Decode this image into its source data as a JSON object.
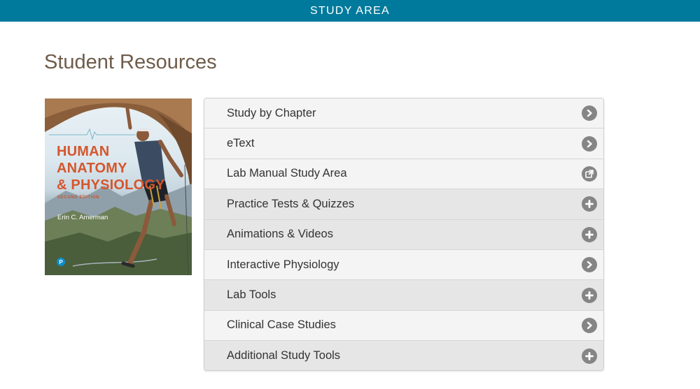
{
  "header": {
    "title": "STUDY AREA"
  },
  "page": {
    "title": "Student Resources"
  },
  "book": {
    "title_lines": [
      "HUMAN",
      "ANATOMY",
      "& PHYSIOLOGY"
    ],
    "edition": "SECOND EDITION",
    "author": "Erin C. Amerman",
    "publisher_logo": "P"
  },
  "menu": {
    "items": [
      {
        "label": "Study by Chapter",
        "icon": "chevron-right-icon"
      },
      {
        "label": "eText",
        "icon": "chevron-right-icon"
      },
      {
        "label": "Lab Manual Study Area",
        "icon": "external-link-icon"
      },
      {
        "label": "Practice Tests & Quizzes",
        "icon": "plus-icon"
      },
      {
        "label": "Animations & Videos",
        "icon": "plus-icon"
      },
      {
        "label": "Interactive Physiology",
        "icon": "chevron-right-icon"
      },
      {
        "label": "Lab Tools",
        "icon": "plus-icon"
      },
      {
        "label": "Clinical Case Studies",
        "icon": "chevron-right-icon"
      },
      {
        "label": "Additional Study Tools",
        "icon": "plus-icon"
      }
    ]
  },
  "colors": {
    "header_bg": "#007a9c",
    "title_text": "#6e5c4a",
    "icon_gray": "#858585",
    "row_light": "#f4f4f4",
    "row_dark": "#e6e6e6",
    "cover_title": "#d5562d"
  }
}
